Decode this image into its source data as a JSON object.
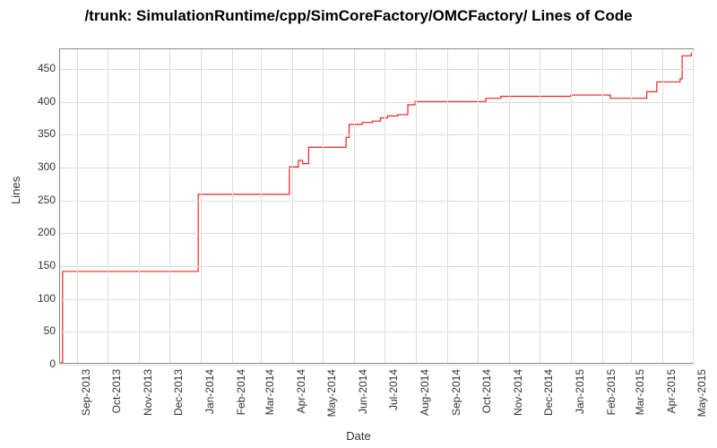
{
  "title": "/trunk: SimulationRuntime/cpp/SimCoreFactory/OMCFactory/ Lines of Code",
  "xlabel": "Date",
  "ylabel": "Lines",
  "chart_data": {
    "type": "line",
    "title": "/trunk: SimulationRuntime/cpp/SimCoreFactory/OMCFactory/ Lines of Code",
    "xlabel": "Date",
    "ylabel": "Lines",
    "ylim": [
      0,
      480
    ],
    "yticks": [
      0,
      50,
      100,
      150,
      200,
      250,
      300,
      350,
      400,
      450
    ],
    "xticks": [
      "Sep-2013",
      "Oct-2013",
      "Nov-2013",
      "Dec-2013",
      "Jan-2014",
      "Feb-2014",
      "Mar-2014",
      "Apr-2014",
      "May-2014",
      "Jun-2014",
      "Jul-2014",
      "Aug-2014",
      "Sep-2014",
      "Oct-2014",
      "Nov-2014",
      "Dec-2014",
      "Jan-2015",
      "Feb-2015",
      "Mar-2015",
      "Apr-2015",
      "May-2015"
    ],
    "series": [
      {
        "name": "Lines of Code",
        "points": [
          {
            "x": "2013-08-15",
            "y": 0
          },
          {
            "x": "2013-08-18",
            "y": 140
          },
          {
            "x": "2013-12-28",
            "y": 140
          },
          {
            "x": "2013-12-30",
            "y": 258
          },
          {
            "x": "2014-03-28",
            "y": 258
          },
          {
            "x": "2014-03-30",
            "y": 300
          },
          {
            "x": "2014-04-05",
            "y": 300
          },
          {
            "x": "2014-04-08",
            "y": 310
          },
          {
            "x": "2014-04-12",
            "y": 305
          },
          {
            "x": "2014-04-18",
            "y": 330
          },
          {
            "x": "2014-05-15",
            "y": 330
          },
          {
            "x": "2014-05-25",
            "y": 345
          },
          {
            "x": "2014-05-28",
            "y": 365
          },
          {
            "x": "2014-06-10",
            "y": 368
          },
          {
            "x": "2014-06-20",
            "y": 370
          },
          {
            "x": "2014-06-28",
            "y": 375
          },
          {
            "x": "2014-07-05",
            "y": 378
          },
          {
            "x": "2014-07-15",
            "y": 380
          },
          {
            "x": "2014-07-25",
            "y": 395
          },
          {
            "x": "2014-08-01",
            "y": 400
          },
          {
            "x": "2014-10-05",
            "y": 400
          },
          {
            "x": "2014-10-10",
            "y": 405
          },
          {
            "x": "2014-10-25",
            "y": 408
          },
          {
            "x": "2014-12-28",
            "y": 408
          },
          {
            "x": "2015-01-02",
            "y": 410
          },
          {
            "x": "2015-02-05",
            "y": 410
          },
          {
            "x": "2015-02-10",
            "y": 405
          },
          {
            "x": "2015-03-10",
            "y": 405
          },
          {
            "x": "2015-03-18",
            "y": 415
          },
          {
            "x": "2015-03-28",
            "y": 430
          },
          {
            "x": "2015-04-20",
            "y": 435
          },
          {
            "x": "2015-04-22",
            "y": 470
          },
          {
            "x": "2015-05-01",
            "y": 475
          }
        ]
      }
    ]
  }
}
